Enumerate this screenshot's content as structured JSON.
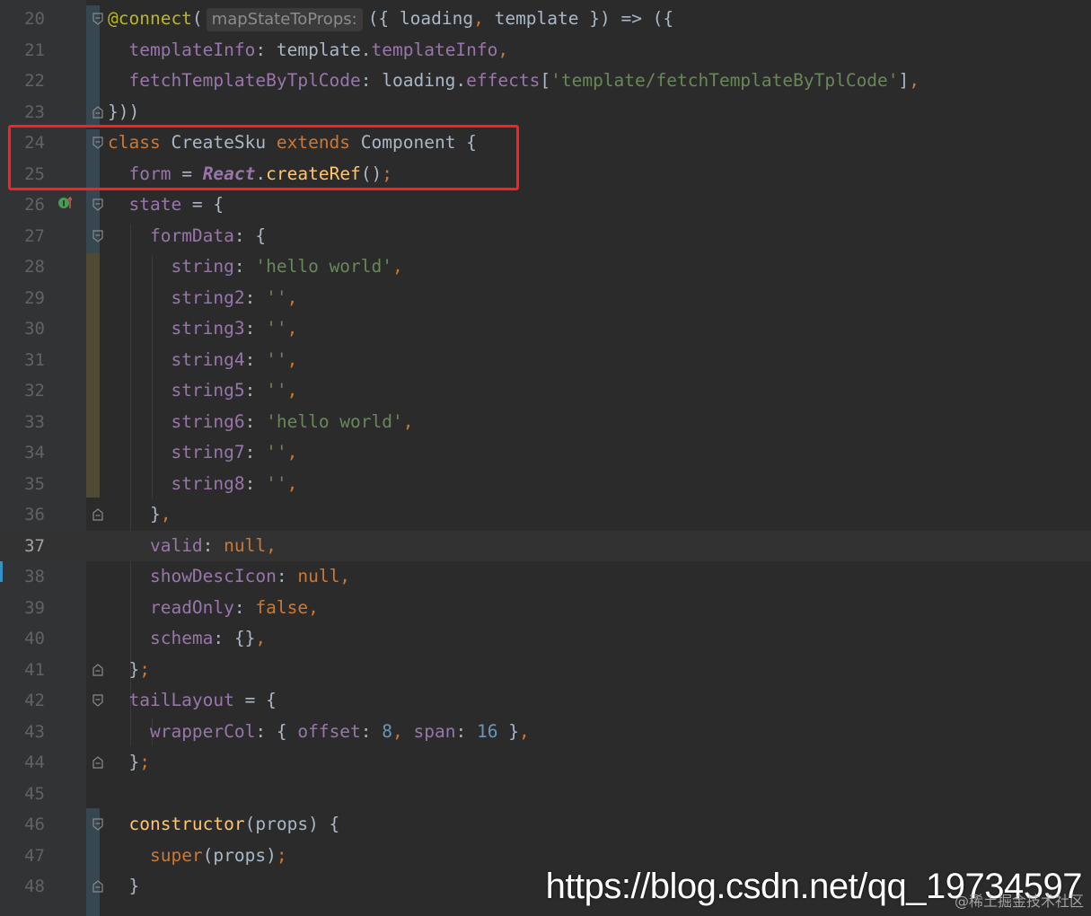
{
  "editor": {
    "theme_colors": {
      "background": "#2b2b2b",
      "gutter": "#313335",
      "keyword": "#cc7832",
      "string": "#6a8759",
      "number": "#6897bb",
      "property": "#9876aa",
      "function": "#ffc66d",
      "annotation": "#bbb529",
      "highlight_box": "#ff1f1f"
    },
    "current_line": "37",
    "lines": [
      {
        "n": "20",
        "fold": "open",
        "tokens": [
          [
            "ann",
            "@connect"
          ],
          [
            "plain",
            "("
          ],
          [
            "hint",
            "mapStateToProps:"
          ],
          [
            "plain",
            "({ loading"
          ],
          [
            "kw",
            ","
          ],
          [
            "plain",
            " template }) => ({"
          ]
        ]
      },
      {
        "n": "21",
        "tokens": [
          [
            "plain",
            "  "
          ],
          [
            "prop",
            "templateInfo"
          ],
          [
            "plain",
            ": template."
          ],
          [
            "prop",
            "templateInfo"
          ],
          [
            "kw",
            ","
          ]
        ]
      },
      {
        "n": "22",
        "tokens": [
          [
            "plain",
            "  "
          ],
          [
            "prop",
            "fetchTemplateByTplCode"
          ],
          [
            "plain",
            ": loading."
          ],
          [
            "prop",
            "effects"
          ],
          [
            "plain",
            "["
          ],
          [
            "str",
            "'template/fetchTemplateByTplCode'"
          ],
          [
            "plain",
            "]"
          ],
          [
            "kw",
            ","
          ]
        ]
      },
      {
        "n": "23",
        "fold": "end",
        "tokens": [
          [
            "plain",
            "}))"
          ]
        ]
      },
      {
        "n": "24",
        "fold": "open",
        "tokens": [
          [
            "kw",
            "class "
          ],
          [
            "plain",
            "CreateSku "
          ],
          [
            "kw",
            "extends "
          ],
          [
            "plain",
            "Component {"
          ]
        ]
      },
      {
        "n": "25",
        "tokens": [
          [
            "plain",
            "  "
          ],
          [
            "prop",
            "form"
          ],
          [
            "plain",
            " = "
          ],
          [
            "cls",
            "React"
          ],
          [
            "plain",
            "."
          ],
          [
            "fn",
            "createRef"
          ],
          [
            "plain",
            "()"
          ],
          [
            "kw",
            ";"
          ]
        ]
      },
      {
        "n": "26",
        "fold": "open",
        "icon": "override-icon",
        "tokens": [
          [
            "plain",
            "  "
          ],
          [
            "prop",
            "state"
          ],
          [
            "plain",
            " = {"
          ]
        ]
      },
      {
        "n": "27",
        "fold": "open",
        "tokens": [
          [
            "plain",
            "    "
          ],
          [
            "prop",
            "formData"
          ],
          [
            "plain",
            ": {"
          ]
        ]
      },
      {
        "n": "28",
        "tokens": [
          [
            "plain",
            "      "
          ],
          [
            "prop",
            "string"
          ],
          [
            "plain",
            ": "
          ],
          [
            "str",
            "'hello world'"
          ],
          [
            "kw",
            ","
          ]
        ]
      },
      {
        "n": "29",
        "tokens": [
          [
            "plain",
            "      "
          ],
          [
            "prop",
            "string2"
          ],
          [
            "plain",
            ": "
          ],
          [
            "str",
            "''"
          ],
          [
            "kw",
            ","
          ]
        ]
      },
      {
        "n": "30",
        "tokens": [
          [
            "plain",
            "      "
          ],
          [
            "prop",
            "string3"
          ],
          [
            "plain",
            ": "
          ],
          [
            "str",
            "''"
          ],
          [
            "kw",
            ","
          ]
        ]
      },
      {
        "n": "31",
        "tokens": [
          [
            "plain",
            "      "
          ],
          [
            "prop",
            "string4"
          ],
          [
            "plain",
            ": "
          ],
          [
            "str",
            "''"
          ],
          [
            "kw",
            ","
          ]
        ]
      },
      {
        "n": "32",
        "tokens": [
          [
            "plain",
            "      "
          ],
          [
            "prop",
            "string5"
          ],
          [
            "plain",
            ": "
          ],
          [
            "str",
            "''"
          ],
          [
            "kw",
            ","
          ]
        ]
      },
      {
        "n": "33",
        "tokens": [
          [
            "plain",
            "      "
          ],
          [
            "prop",
            "string6"
          ],
          [
            "plain",
            ": "
          ],
          [
            "str",
            "'hello world'"
          ],
          [
            "kw",
            ","
          ]
        ]
      },
      {
        "n": "34",
        "tokens": [
          [
            "plain",
            "      "
          ],
          [
            "prop",
            "string7"
          ],
          [
            "plain",
            ": "
          ],
          [
            "str",
            "''"
          ],
          [
            "kw",
            ","
          ]
        ]
      },
      {
        "n": "35",
        "tokens": [
          [
            "plain",
            "      "
          ],
          [
            "prop",
            "string8"
          ],
          [
            "plain",
            ": "
          ],
          [
            "str",
            "''"
          ],
          [
            "kw",
            ","
          ]
        ]
      },
      {
        "n": "36",
        "fold": "end",
        "tokens": [
          [
            "plain",
            "    }"
          ],
          [
            "kw",
            ","
          ]
        ]
      },
      {
        "n": "37",
        "tokens": [
          [
            "plain",
            "    "
          ],
          [
            "prop",
            "valid"
          ],
          [
            "plain",
            ": "
          ],
          [
            "kw",
            "null,"
          ]
        ]
      },
      {
        "n": "38",
        "tokens": [
          [
            "plain",
            "    "
          ],
          [
            "prop",
            "showDescIcon"
          ],
          [
            "plain",
            ": "
          ],
          [
            "kw",
            "null,"
          ]
        ]
      },
      {
        "n": "39",
        "tokens": [
          [
            "plain",
            "    "
          ],
          [
            "prop",
            "readOnly"
          ],
          [
            "plain",
            ": "
          ],
          [
            "kw",
            "false,"
          ]
        ]
      },
      {
        "n": "40",
        "tokens": [
          [
            "plain",
            "    "
          ],
          [
            "prop",
            "schema"
          ],
          [
            "plain",
            ": {}"
          ],
          [
            "kw",
            ","
          ]
        ]
      },
      {
        "n": "41",
        "fold": "end",
        "tokens": [
          [
            "plain",
            "  }"
          ],
          [
            "kw",
            ";"
          ]
        ]
      },
      {
        "n": "42",
        "fold": "open",
        "tokens": [
          [
            "plain",
            "  "
          ],
          [
            "prop",
            "tailLayout"
          ],
          [
            "plain",
            " = {"
          ]
        ]
      },
      {
        "n": "43",
        "tokens": [
          [
            "plain",
            "    "
          ],
          [
            "prop",
            "wrapperCol"
          ],
          [
            "plain",
            ": { "
          ],
          [
            "prop",
            "offset"
          ],
          [
            "plain",
            ": "
          ],
          [
            "num",
            "8"
          ],
          [
            "kw",
            ", "
          ],
          [
            "prop",
            "span"
          ],
          [
            "plain",
            ": "
          ],
          [
            "num",
            "16"
          ],
          [
            "plain",
            " }"
          ],
          [
            "kw",
            ","
          ]
        ]
      },
      {
        "n": "44",
        "fold": "end",
        "tokens": [
          [
            "plain",
            "  }"
          ],
          [
            "kw",
            ";"
          ]
        ]
      },
      {
        "n": "45",
        "tokens": []
      },
      {
        "n": "46",
        "fold": "open",
        "tokens": [
          [
            "plain",
            "  "
          ],
          [
            "fn",
            "constructor"
          ],
          [
            "plain",
            "(props) {"
          ]
        ]
      },
      {
        "n": "47",
        "tokens": [
          [
            "plain",
            "    "
          ],
          [
            "kw",
            "super"
          ],
          [
            "plain",
            "(props)"
          ],
          [
            "kw",
            ";"
          ]
        ]
      },
      {
        "n": "48",
        "fold": "end",
        "tokens": [
          [
            "plain",
            "  }"
          ]
        ]
      }
    ]
  },
  "watermark": {
    "url": "https://blog.csdn.net/qq_19734597",
    "community": "@稀土掘金技术社区"
  }
}
